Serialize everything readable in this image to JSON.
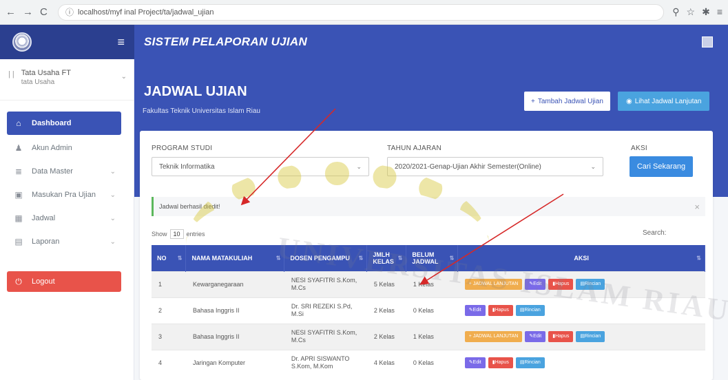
{
  "browser": {
    "url": "localhost/myf inal Project/ta/jadwal_ujian",
    "nav_back": "←",
    "nav_forward": "→",
    "nav_reload": "C",
    "info": "ⓘ",
    "right_icons": [
      "⚲",
      "☆",
      "✱",
      "≡"
    ]
  },
  "topbar": {
    "app_title": "SISTEM PELAPORAN UJIAN",
    "menu_icon": "≡"
  },
  "sidebar": {
    "user_name": "Tata Usaha FT",
    "user_role": "tata Usaha",
    "items": [
      {
        "label": "Dashboard",
        "icon": "home-icon",
        "glyph": "⌂"
      },
      {
        "label": "Akun Admin",
        "icon": "user-icon",
        "glyph": "♟"
      },
      {
        "label": "Data Master",
        "icon": "database-icon",
        "glyph": "≣"
      },
      {
        "label": "Masukan Pra Ujian",
        "icon": "form-icon",
        "glyph": "▣"
      },
      {
        "label": "Jadwal",
        "icon": "calendar-icon",
        "glyph": "▦"
      },
      {
        "label": "Laporan",
        "icon": "report-icon",
        "glyph": "▤"
      },
      {
        "label": "Logout",
        "icon": "power-icon",
        "glyph": "⏻"
      }
    ]
  },
  "hero": {
    "title": "JADWAL UJIAN",
    "subtitle": "Fakultas Teknik Universitas Islam Riau",
    "btn_add": "Tambah Jadwal Ujian",
    "btn_add_icon": "+",
    "btn_see": "Lihat Jadwal Lanjutan",
    "btn_see_icon": "◉"
  },
  "filters": {
    "program_label": "PROGRAM STUDI",
    "program_value": "Teknik Informatika",
    "tahun_label": "TAHUN AJARAN",
    "tahun_value": "2020/2021-Genap-Ujian Akhir Semester(Online)",
    "aksi_label": "AKSI",
    "search_button": "Cari Sekarang"
  },
  "alert": {
    "message": "Jadwal berhasil diedit!",
    "close": "×"
  },
  "table_controls": {
    "show": "Show",
    "entries_value": "10",
    "entries": "entries",
    "search": "Search:"
  },
  "table": {
    "headers": [
      "NO",
      "NAMA MATAKULIAH",
      "DOSEN PENGAMPU",
      "JMLH KELAS",
      "BELUM JADWAL",
      "AKSI"
    ],
    "rows": [
      {
        "no": "1",
        "matakuliah": "Kewarganegaraan",
        "dosen": "NESI SYAFITRI S.Kom, M.Cs",
        "kelas": "5 Kelas",
        "belum": "1 Kelas",
        "jadwal_btn": true
      },
      {
        "no": "2",
        "matakuliah": "Bahasa Inggris II",
        "dosen": "Dr. SRI REZEKI S.Pd, M.Si",
        "kelas": "2 Kelas",
        "belum": "0 Kelas",
        "jadwal_btn": false
      },
      {
        "no": "3",
        "matakuliah": "Bahasa Inggris II",
        "dosen": "NESI SYAFITRI S.Kom, M.Cs",
        "kelas": "2 Kelas",
        "belum": "1 Kelas",
        "jadwal_btn": true
      },
      {
        "no": "4",
        "matakuliah": "Jaringan Komputer",
        "dosen": "Dr. APRI SISWANTO S.Kom, M.Kom",
        "kelas": "4 Kelas",
        "belum": "0 Kelas",
        "jadwal_btn": false
      }
    ],
    "btn_jadwal": "+ JADWAL LANJUTAN",
    "btn_edit": "✎Edit",
    "btn_hapus": "▮Hapus",
    "btn_rincian": "▤Rincian"
  },
  "watermark": "UNIVERSITAS ISLAM RIAU",
  "colors": {
    "primary": "#3a53b5",
    "sidebar_dark": "#2b3f8f",
    "danger": "#e8534a",
    "info": "#4aa3df",
    "warning": "#f0ad4e",
    "arrow": "#d62828"
  }
}
